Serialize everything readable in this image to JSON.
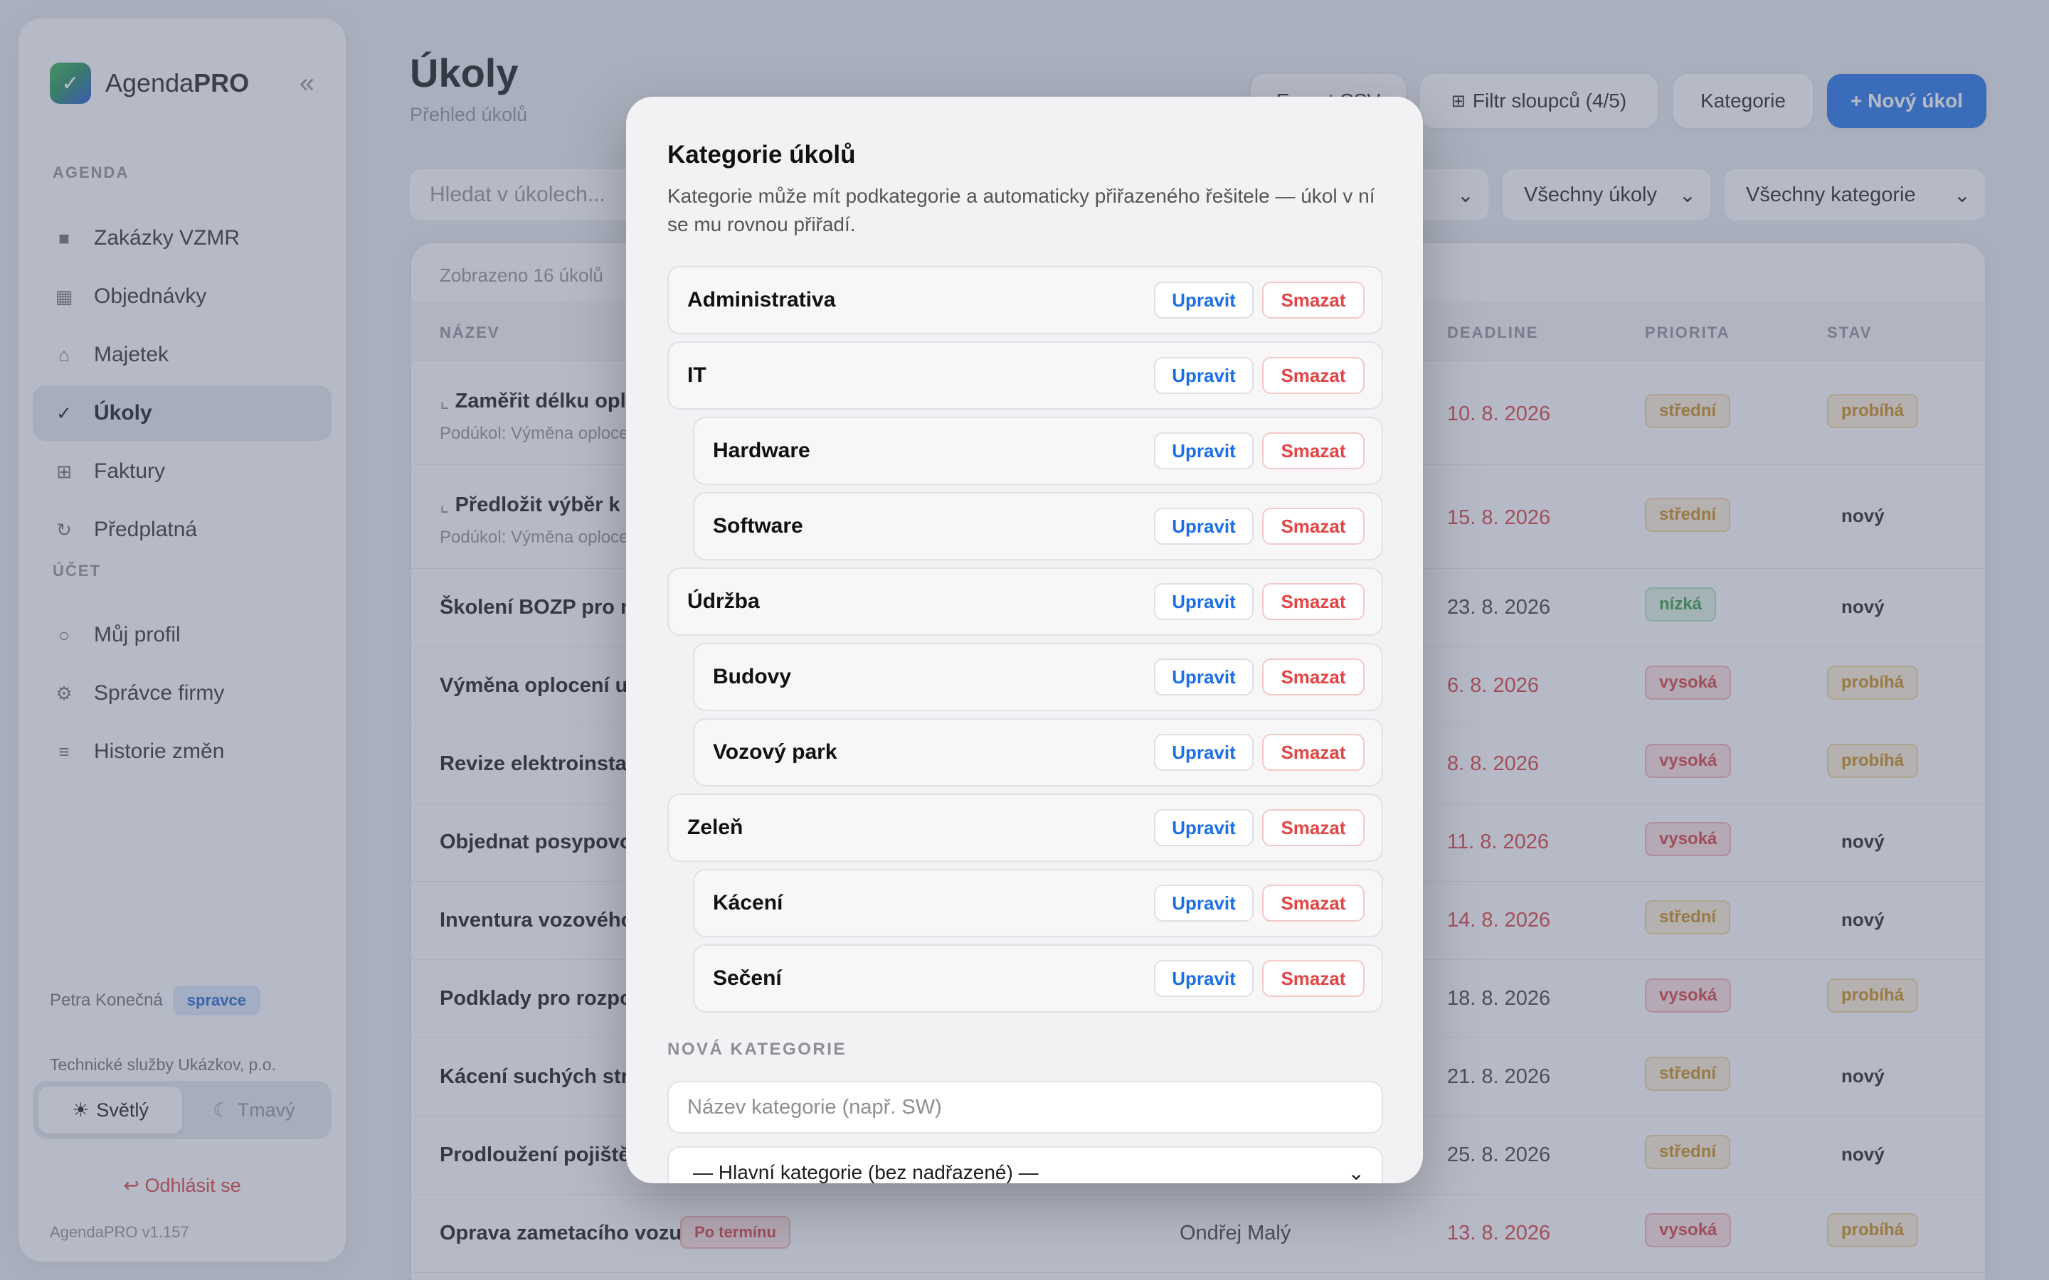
{
  "sidebar": {
    "brand_prefix": "Agenda",
    "brand_suffix": "PRO",
    "collapse_icon": "«",
    "section_agenda": "AGENDA",
    "section_account": "ÚČET",
    "items": [
      {
        "label": "Zakázky VZMR",
        "icon": "■"
      },
      {
        "label": "Objednávky",
        "icon": "▦"
      },
      {
        "label": "Majetek",
        "icon": "⌂"
      },
      {
        "label": "Úkoly",
        "icon": "✓"
      },
      {
        "label": "Faktury",
        "icon": "⊞"
      },
      {
        "label": "Předplatná",
        "icon": "↻"
      }
    ],
    "account_items": [
      {
        "label": "Můj profil",
        "icon": "○"
      },
      {
        "label": "Správce firmy",
        "icon": "⚙"
      },
      {
        "label": "Historie změn",
        "icon": "≡"
      }
    ],
    "user_name": "Petra Konečná",
    "user_role": "spravce",
    "org": "Technické služby Ukázkov, p.o.",
    "theme_light": "Světlý",
    "theme_dark": "Tmavý",
    "logout": "Odhlásit se",
    "version": "AgendaPRO v1.157"
  },
  "header": {
    "title": "Úkoly",
    "subtitle": "Přehled úkolů",
    "btn_export": "Export CSV",
    "btn_filter": "Filtr sloupců (4/5)",
    "btn_categories": "Kategorie",
    "btn_new": "+ Nový úkol"
  },
  "filters": {
    "search_placeholder": "Hledat v úkolech...",
    "select_scope": "Všechny úkoly",
    "select_category": "Všechny kategorie"
  },
  "table": {
    "shown": "Zobrazeno 16 úkolů",
    "columns": {
      "name": "NÁZEV",
      "deadline": "DEADLINE",
      "priority": "PRIORITA",
      "status": "STAV"
    },
    "rows": [
      {
        "title": "Zaměřit délku opl",
        "sub": "Podúkol: Výměna oploce",
        "deadline": "10. 8. 2026",
        "priority": "střední",
        "status": "probíhá"
      },
      {
        "title": "Předložit výběr k",
        "sub": "Podúkol: Výměna oploce",
        "deadline": "15. 8. 2026",
        "priority": "střední",
        "status": "nový"
      },
      {
        "title": "Školení BOZP pro no",
        "deadline": "23. 8. 2026",
        "priority": "nízká",
        "status": "nový"
      },
      {
        "title": "Výměna oplocení u s",
        "deadline": "6. 8. 2026",
        "priority": "vysoká",
        "status": "probíhá"
      },
      {
        "title": "Revize elektroinstala",
        "deadline": "8. 8. 2026",
        "priority": "vysoká",
        "status": "probíhá"
      },
      {
        "title": "Objednat posypovou",
        "deadline": "11. 8. 2026",
        "priority": "vysoká",
        "status": "nový"
      },
      {
        "title": "Inventura vozového",
        "deadline": "14. 8. 2026",
        "priority": "střední",
        "status": "nový"
      },
      {
        "title": "Podklady pro rozpo",
        "deadline": "18. 8. 2026",
        "priority": "vysoká",
        "status": "probíhá"
      },
      {
        "title": "Kácení suchých stro",
        "deadline": "21. 8. 2026",
        "priority": "střední",
        "status": "nový"
      },
      {
        "title": "Prodloužení pojištěn",
        "deadline": "25. 8. 2026",
        "priority": "střední",
        "status": "nový"
      },
      {
        "title": "Oprava zametacího vozu",
        "late_badge": "Po termínu",
        "person": "Ondřej Malý",
        "deadline": "13. 8. 2026",
        "priority": "vysoká",
        "status": "probíhá"
      }
    ]
  },
  "modal": {
    "title": "Kategorie úkolů",
    "description": "Kategorie může mít podkategorie a automaticky přiřazeného řešitele — úkol v ní se mu rovnou přiřadí.",
    "edit_label": "Upravit",
    "delete_label": "Smazat",
    "categories": [
      {
        "name": "Administrativa",
        "level": 0
      },
      {
        "name": "IT",
        "level": 0
      },
      {
        "name": "Hardware",
        "level": 1
      },
      {
        "name": "Software",
        "level": 1
      },
      {
        "name": "Údržba",
        "level": 0
      },
      {
        "name": "Budovy",
        "level": 1
      },
      {
        "name": "Vozový park",
        "level": 1
      },
      {
        "name": "Zeleň",
        "level": 0
      },
      {
        "name": "Kácení",
        "level": 1
      },
      {
        "name": "Sečení",
        "level": 1
      }
    ],
    "new_section": "NOVÁ KATEGORIE",
    "new_name_placeholder": "Název kategorie (např. SW)",
    "parent_select": "— Hlavní kategorie (bez nadřazené) —"
  },
  "colors": {
    "accent": "#1d6fe8",
    "danger": "#e24545",
    "overlay": "#606882"
  }
}
